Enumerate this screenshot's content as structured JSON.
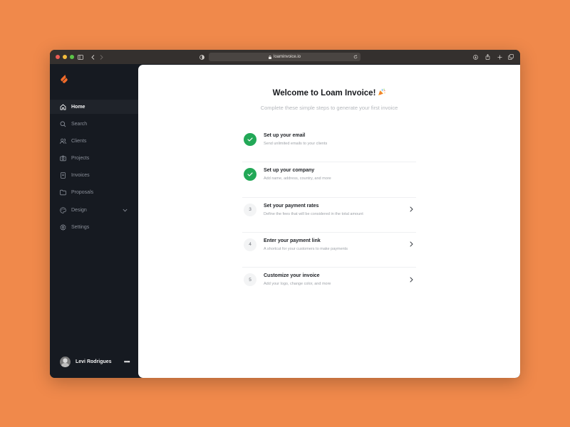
{
  "browser": {
    "url": "loaminvoice.io"
  },
  "sidebar": {
    "items": [
      {
        "label": "Home",
        "icon": "home-icon"
      },
      {
        "label": "Search",
        "icon": "search-icon"
      },
      {
        "label": "Clients",
        "icon": "users-icon"
      },
      {
        "label": "Projects",
        "icon": "camera-icon"
      },
      {
        "label": "Invoices",
        "icon": "document-icon"
      },
      {
        "label": "Proposals",
        "icon": "folder-icon"
      },
      {
        "label": "Design",
        "icon": "palette-icon"
      },
      {
        "label": "Settings",
        "icon": "gear-icon"
      }
    ],
    "active_item": "Home"
  },
  "user": {
    "name": "Levi Rodrigues",
    "more_label": "•••"
  },
  "main": {
    "title": "Welcome to Loam Invoice!",
    "subtitle": "Complete these simple steps to generate your first invoice",
    "steps": [
      {
        "number": "1",
        "status": "done",
        "title": "Set up your email",
        "description": "Send unlimited emails to your clients"
      },
      {
        "number": "2",
        "status": "done",
        "title": "Set up your company",
        "description": "Add name, address, country, and more"
      },
      {
        "number": "3",
        "status": "todo",
        "title": "Set your payment rates",
        "description": "Define the fees that will be considered in the total amount"
      },
      {
        "number": "4",
        "status": "todo",
        "title": "Enter your payment link",
        "description": "A shortcut for your customers to make payments"
      },
      {
        "number": "5",
        "status": "todo",
        "title": "Customize your invoice",
        "description": "Add your logo, change color, and more"
      }
    ]
  },
  "colors": {
    "background": "#F0894B",
    "sidebar": "#161A21",
    "accent_orange": "#F26B2A",
    "success_green": "#22A857"
  }
}
